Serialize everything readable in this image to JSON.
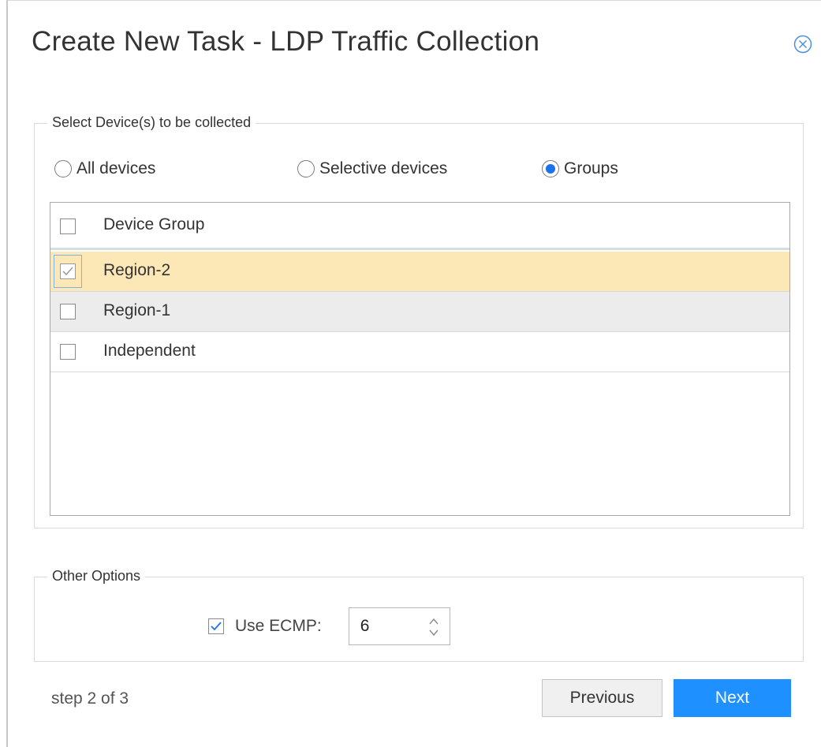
{
  "dialog": {
    "title": "Create New Task - LDP Traffic Collection",
    "close_icon": "close-circle-icon"
  },
  "devices": {
    "legend": "Select Device(s) to be collected",
    "radio_options": [
      {
        "label": "All devices",
        "selected": false
      },
      {
        "label": "Selective devices",
        "selected": false
      },
      {
        "label": "Groups",
        "selected": true
      }
    ],
    "grid": {
      "header": "Device Group",
      "rows": [
        {
          "label": "Region-2",
          "checked": true
        },
        {
          "label": "Region-1",
          "checked": false
        },
        {
          "label": "Independent",
          "checked": false
        }
      ]
    }
  },
  "options": {
    "legend": "Other Options",
    "ecmp_label": "Use ECMP:",
    "ecmp_checked": true,
    "ecmp_value": "6"
  },
  "footer": {
    "step": "step 2 of 3",
    "previous_label": "Previous",
    "next_label": "Next"
  },
  "colors": {
    "selected_row": "#fce8b6",
    "alt_row": "#ececec",
    "accent": "#1a73e8",
    "next_button": "#1e90ff"
  }
}
